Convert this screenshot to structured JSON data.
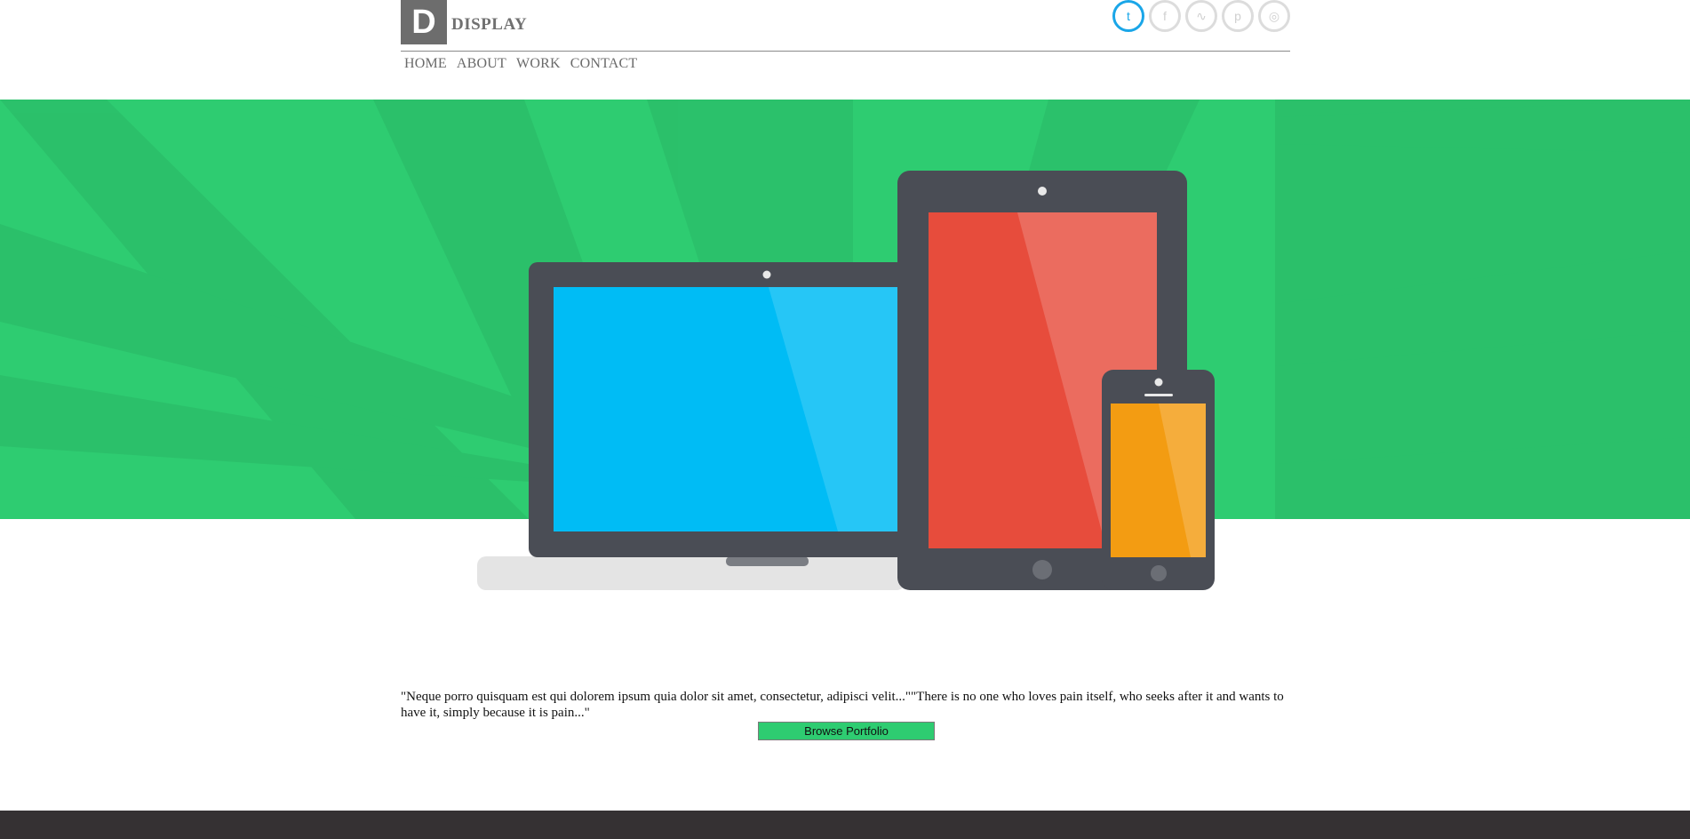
{
  "brand": {
    "logo_letter": "D",
    "name": "DISPLAY"
  },
  "social": [
    {
      "name": "twitter",
      "glyph": "t",
      "active": true
    },
    {
      "name": "facebook",
      "glyph": "f",
      "active": false
    },
    {
      "name": "rss",
      "glyph": "∿",
      "active": false
    },
    {
      "name": "pinterest",
      "glyph": "p",
      "active": false
    },
    {
      "name": "dribbble",
      "glyph": "◎",
      "active": false
    }
  ],
  "nav": [
    {
      "label": "HOME"
    },
    {
      "label": "ABOUT"
    },
    {
      "label": "WORK"
    },
    {
      "label": "CONTACT"
    }
  ],
  "hero": {
    "background": "#2ecc71",
    "laptop_screen": "#00bcf5",
    "tablet_screen": "#e74c3c",
    "phone_screen": "#f39c12",
    "device_frame": "#4a4d55"
  },
  "content": {
    "quote": "\"Neque porro quisquam est qui dolorem ipsum quia dolor sit amet, consectetur, adipisci velit...\"\"There is no one who loves pain itself, who seeks after it and wants to have it, simply because it is pain...\"",
    "browse_label": "Browse Portfolio"
  },
  "colors": {
    "accent": "#2ecc71",
    "footer": "#353133"
  }
}
